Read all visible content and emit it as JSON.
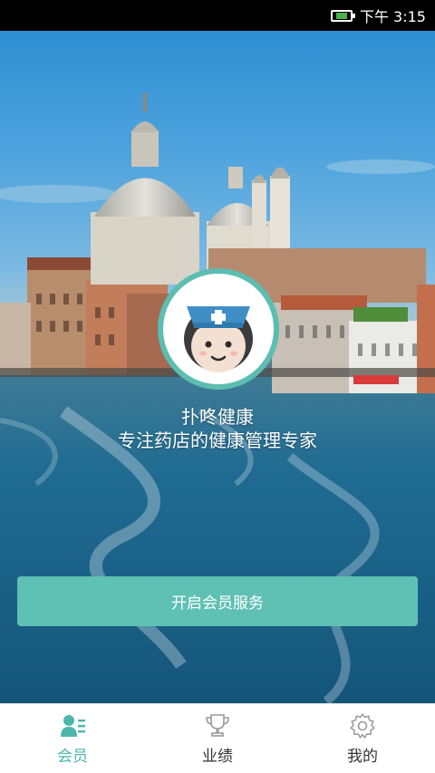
{
  "status_bar": {
    "time": "下午 3:15",
    "battery_icon": "battery-icon"
  },
  "hero": {
    "app_name": "扑咚健康",
    "tagline": "专注药店的健康管理专家",
    "avatar_icon": "nurse-avatar-icon"
  },
  "cta": {
    "label": "开启会员服务"
  },
  "bottom_nav": {
    "items": [
      {
        "label": "会员",
        "icon": "member-icon",
        "active": true
      },
      {
        "label": "业绩",
        "icon": "trophy-icon",
        "active": false
      },
      {
        "label": "我的",
        "icon": "gear-icon",
        "active": false
      }
    ]
  },
  "colors": {
    "accent": "#5fc0b4",
    "active_nav": "#4db6ac",
    "status_bar": "#000000"
  }
}
